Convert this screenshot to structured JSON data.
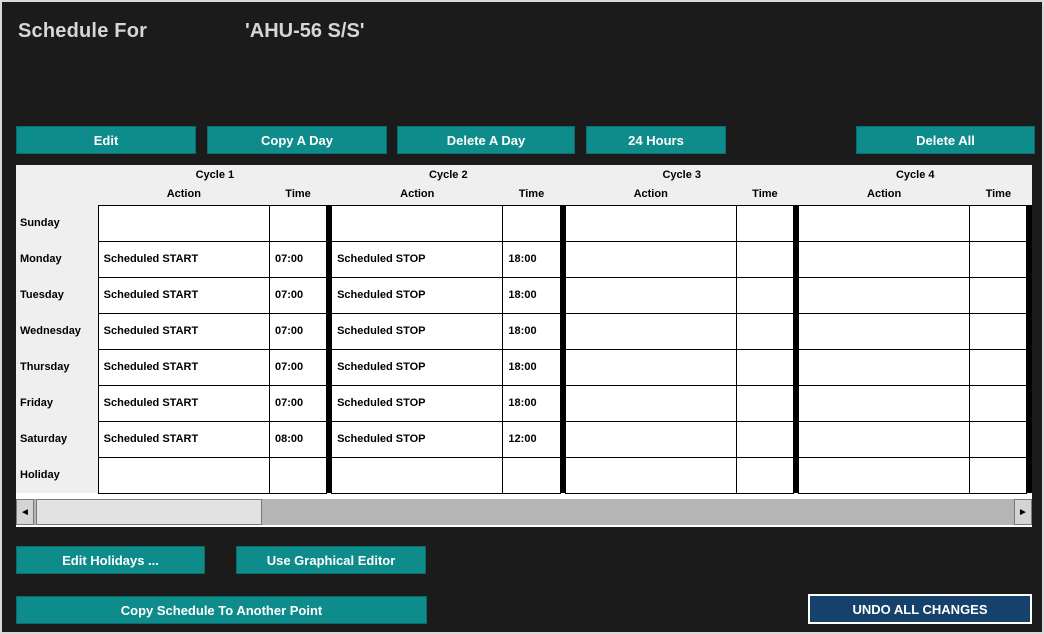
{
  "colors": {
    "teal_button": "#0E8B8B",
    "undo_button": "#15416B",
    "window_background": "#1B1B1B",
    "table_header_background": "#EFEFEF"
  },
  "header": {
    "title": "Schedule For",
    "point_name": "'AHU-56 S/S'"
  },
  "toolbar": {
    "edit": "Edit",
    "copy_a_day": "Copy A Day",
    "delete_a_day": "Delete A Day",
    "hours24": "24 Hours",
    "delete_all": "Delete All"
  },
  "table": {
    "cycle_headers": [
      "Cycle 1",
      "Cycle 2",
      "Cycle 3",
      "Cycle 4"
    ],
    "action_label": "Action",
    "time_label": "Time",
    "rows": [
      {
        "day": "Sunday",
        "cells": [
          "",
          "",
          "",
          "",
          "",
          "",
          "",
          ""
        ]
      },
      {
        "day": "Monday",
        "cells": [
          "Scheduled START",
          "07:00",
          "Scheduled STOP",
          "18:00",
          "",
          "",
          "",
          ""
        ]
      },
      {
        "day": "Tuesday",
        "cells": [
          "Scheduled START",
          "07:00",
          "Scheduled STOP",
          "18:00",
          "",
          "",
          "",
          ""
        ]
      },
      {
        "day": "Wednesday",
        "cells": [
          "Scheduled START",
          "07:00",
          "Scheduled STOP",
          "18:00",
          "",
          "",
          "",
          ""
        ]
      },
      {
        "day": "Thursday",
        "cells": [
          "Scheduled START",
          "07:00",
          "Scheduled STOP",
          "18:00",
          "",
          "",
          "",
          ""
        ]
      },
      {
        "day": "Friday",
        "cells": [
          "Scheduled START",
          "07:00",
          "Scheduled STOP",
          "18:00",
          "",
          "",
          "",
          ""
        ]
      },
      {
        "day": "Saturday",
        "cells": [
          "Scheduled START",
          "08:00",
          "Scheduled STOP",
          "12:00",
          "",
          "",
          "",
          ""
        ]
      },
      {
        "day": "Holiday",
        "cells": [
          "",
          "",
          "",
          "",
          "",
          "",
          "",
          ""
        ]
      }
    ]
  },
  "scrollbar": {
    "left_arrow": "◄",
    "right_arrow": "►"
  },
  "footer": {
    "edit_holidays": "Edit Holidays ...",
    "use_graphical_editor": "Use Graphical Editor",
    "copy_schedule": "Copy Schedule To Another Point",
    "undo_all": "UNDO ALL CHANGES"
  }
}
